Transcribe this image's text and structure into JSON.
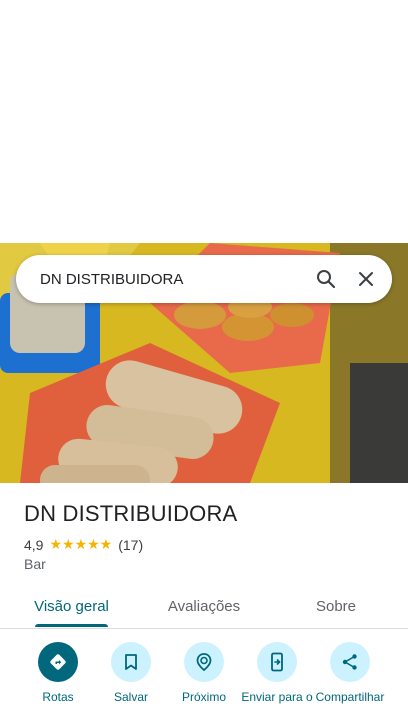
{
  "search": {
    "query": "DN DISTRIBUIDORA"
  },
  "place": {
    "name": "DN DISTRIBUIDORA",
    "rating": "4,9",
    "stars": "★★★★★",
    "review_count": "(17)",
    "category": "Bar",
    "photo_alt": "breads on orange trays over a yellow tablecloth"
  },
  "tabs": [
    {
      "label": "Visão geral",
      "active": true
    },
    {
      "label": "Avaliações",
      "active": false
    },
    {
      "label": "Sobre",
      "active": false
    }
  ],
  "actions": [
    {
      "label": "Rotas",
      "icon": "directions-icon"
    },
    {
      "label": "Salvar",
      "icon": "bookmark-icon"
    },
    {
      "label": "Próximo",
      "icon": "nearby-icon"
    },
    {
      "label": "Enviar para o",
      "icon": "send-to-phone-icon"
    },
    {
      "label": "Compartilhar",
      "icon": "share-icon"
    }
  ],
  "colors": {
    "accent": "#00677d",
    "action_bg": "#cdf2ff",
    "star": "#f5b400"
  }
}
